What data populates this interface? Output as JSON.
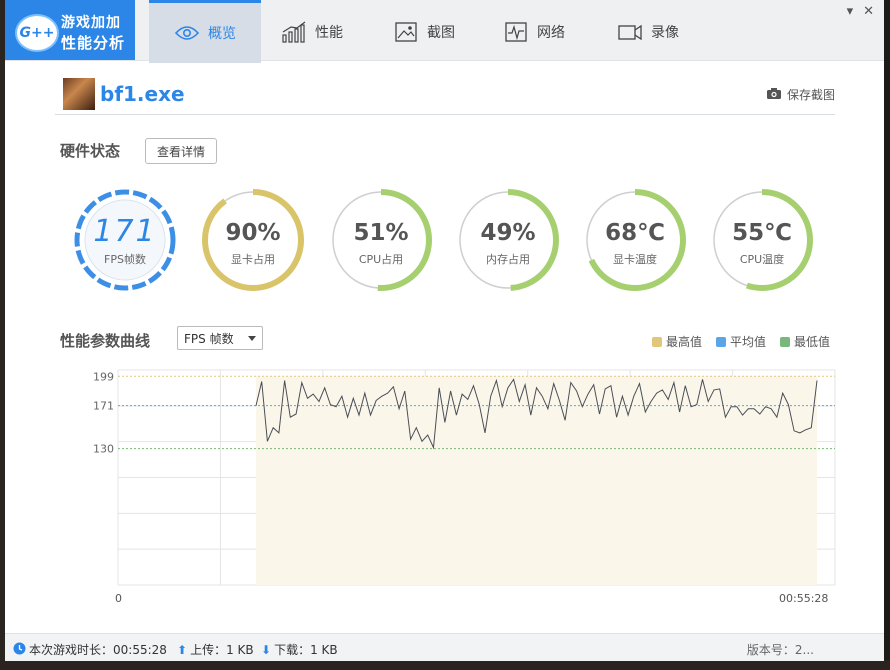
{
  "app": {
    "logo_badge": "G++",
    "logo_line1": "游戏加加",
    "logo_line2": "性能分析"
  },
  "tabs": [
    {
      "label": "概览",
      "icon": "eye-icon",
      "active": true
    },
    {
      "label": "性能",
      "icon": "performance-chart-icon",
      "active": false
    },
    {
      "label": "截图",
      "icon": "image-icon",
      "active": false
    },
    {
      "label": "网络",
      "icon": "network-pulse-icon",
      "active": false
    },
    {
      "label": "录像",
      "icon": "video-camera-icon",
      "active": false
    }
  ],
  "window_controls": {
    "minimize": "▾",
    "close": "✕"
  },
  "game": {
    "name": "bf1.exe",
    "save_screenshot": "保存截图"
  },
  "hardware": {
    "title": "硬件状态",
    "detail_button": "查看详情",
    "fps": {
      "value": "171",
      "label": "FPS帧数"
    },
    "gauges": [
      {
        "value": "90%",
        "label": "显卡占用",
        "fraction": 0.9
      },
      {
        "value": "51%",
        "label": "CPU占用",
        "fraction": 0.51
      },
      {
        "value": "49%",
        "label": "内存占用",
        "fraction": 0.49
      },
      {
        "value": "68℃",
        "label": "显卡温度",
        "fraction": 0.68
      },
      {
        "value": "55℃",
        "label": "CPU温度",
        "fraction": 0.55
      }
    ]
  },
  "curve": {
    "title": "性能参数曲线",
    "select_value": "FPS 帧数",
    "legend": [
      {
        "label": "最高值",
        "color": "#e2c77a"
      },
      {
        "label": "平均值",
        "color": "#5aa5e8"
      },
      {
        "label": "最低值",
        "color": "#79b87a"
      }
    ],
    "x_start_label": "0",
    "x_end_label": "00:55:28"
  },
  "chart_data": {
    "type": "line",
    "y_ticks": [
      "199",
      "171",
      "130"
    ],
    "max": 199,
    "avg": 171,
    "min": 130,
    "ylim": [
      0,
      205
    ],
    "values": [
      171,
      194,
      137,
      150,
      145,
      195,
      160,
      163,
      193,
      178,
      182,
      175,
      188,
      172,
      170,
      180,
      160,
      178,
      162,
      183,
      162,
      176,
      180,
      183,
      189,
      168,
      185,
      139,
      150,
      137,
      143,
      131,
      188,
      155,
      185,
      162,
      182,
      177,
      190,
      172,
      145,
      180,
      195,
      170,
      188,
      196,
      175,
      191,
      162,
      188,
      180,
      168,
      192,
      176,
      157,
      193,
      185,
      170,
      182,
      191,
      163,
      187,
      190,
      160,
      180,
      162,
      180,
      192,
      165,
      175,
      183,
      186,
      177,
      193,
      165,
      190,
      170,
      172,
      196,
      175,
      186,
      187,
      160,
      170,
      170,
      162,
      168,
      168,
      163,
      170,
      168,
      160,
      183,
      172,
      147,
      145,
      148,
      150,
      195
    ],
    "x_start": "0",
    "x_end": "00:55:28"
  },
  "status": {
    "duration": "本次游戏时长：00:55:28",
    "upload": "上传：1 KB",
    "download": "下载：1 KB",
    "version": "版本号：2..."
  }
}
